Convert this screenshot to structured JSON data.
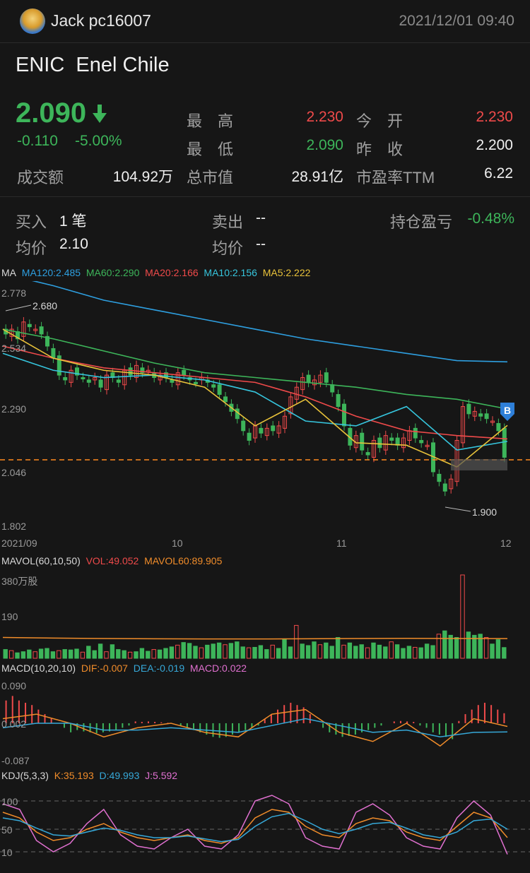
{
  "header": {
    "user": "Jack pc16007",
    "datetime": "2021/12/01 09:40"
  },
  "stock": {
    "ticker": "ENIC",
    "name": "Enel Chile"
  },
  "quote": {
    "price": "2.090",
    "change": "-0.110",
    "change_pct": "-5.00%",
    "turnover_label": "成交额",
    "turnover": "104.92万",
    "high_label": "最　高",
    "high": "2.230",
    "low_label": "最　低",
    "low": "2.090",
    "mktcap_label": "总市值",
    "mktcap": "28.91亿",
    "open_label": "今　开",
    "open": "2.230",
    "prevclose_label": "昨　收",
    "prevclose": "2.200",
    "pe_label": "市盈率TTM",
    "pe": "6.22"
  },
  "position": {
    "buy_label": "买入",
    "buy_value": "1 笔",
    "avg_label": "均价",
    "avg_buy": "2.10",
    "sell_label": "卖出",
    "sell_value": "--",
    "avg_label2": "均价",
    "avg_sell": "--",
    "pnl_label": "持仓盈亏",
    "pnl": "-0.48%"
  },
  "colors": {
    "up": "#ef4a4a",
    "down": "#3db55a",
    "ma120": "#2e9fe0",
    "ma60": "#3db55a",
    "ma20": "#ef4a4a",
    "ma10": "#36c5dd",
    "ma5": "#e8c23a",
    "kdj_k": "#f08c2a",
    "kdj_d": "#36a8d8",
    "kdj_j": "#e070d0"
  },
  "main_legend": {
    "ma": "MA",
    "ma120": "MA120:2.485",
    "ma60": "MA60:2.290",
    "ma20": "MA20:2.166",
    "ma10": "MA10:2.156",
    "ma5": "MA5:2.222"
  },
  "main_axis": {
    "y1": "2.778",
    "y2": "2.534",
    "y3": "2.290",
    "y4": "2.046",
    "y5": "1.802",
    "hi": "2.680",
    "lo": "1.900",
    "x1": "2021/09",
    "x2": "10",
    "x3": "11",
    "x4": "12",
    "badge": "B"
  },
  "vol_legend": {
    "title": "MAVOL(60,10,50)",
    "vol": "VOL:49.052",
    "mavol60": "MAVOL60:89.905",
    "y_top": "380万股",
    "y_mid": "190"
  },
  "macd_legend": {
    "title": "MACD(10,20,10)",
    "dif": "DIF:-0.007",
    "dea": "DEA:-0.019",
    "macd": "MACD:0.022",
    "y_top": "0.090",
    "y_mid": "0.002",
    "y_bot": "-0.087"
  },
  "kdj_legend": {
    "title": "KDJ(5,3,3)",
    "k": "K:35.193",
    "d": "D:49.993",
    "j": "J:5.592",
    "y100": "100",
    "y50": "50",
    "y10": "10"
  },
  "chart_data": [
    {
      "type": "candlestick",
      "title": "ENIC",
      "ylim": [
        1.802,
        2.778
      ],
      "x_ticks": [
        "2021/09",
        "10",
        "11",
        "12"
      ],
      "annotations": {
        "high": 2.68,
        "low": 1.9,
        "last": 2.09
      },
      "closes": [
        2.6,
        2.62,
        2.58,
        2.65,
        2.63,
        2.62,
        2.6,
        2.55,
        2.5,
        2.43,
        2.41,
        2.45,
        2.43,
        2.42,
        2.4,
        2.42,
        2.38,
        2.43,
        2.42,
        2.4,
        2.45,
        2.43,
        2.47,
        2.44,
        2.45,
        2.42,
        2.43,
        2.42,
        2.4,
        2.44,
        2.43,
        2.41,
        2.4,
        2.42,
        2.4,
        2.38,
        2.35,
        2.32,
        2.28,
        2.25,
        2.2,
        2.16,
        2.22,
        2.19,
        2.21,
        2.2,
        2.22,
        2.26,
        2.34,
        2.38,
        2.42,
        2.4,
        2.41,
        2.43,
        2.4,
        2.36,
        2.3,
        2.22,
        2.14,
        2.18,
        2.12,
        2.1,
        2.16,
        2.13,
        2.18,
        2.16,
        2.14,
        2.17,
        2.2,
        2.17,
        2.15,
        2.14,
        2.03,
        1.99,
        1.95,
        2.0,
        2.16,
        2.3,
        2.27,
        2.28,
        2.26,
        2.25,
        2.24,
        2.2,
        2.09
      ],
      "series": [
        {
          "name": "MA120",
          "values": [
            2.85,
            2.8,
            2.74,
            2.7,
            2.66,
            2.62,
            2.58,
            2.55,
            2.52,
            2.49,
            2.485
          ]
        },
        {
          "name": "MA60",
          "values": [
            2.62,
            2.58,
            2.53,
            2.48,
            2.44,
            2.42,
            2.4,
            2.38,
            2.35,
            2.33,
            2.29
          ]
        },
        {
          "name": "MA20",
          "values": [
            2.55,
            2.5,
            2.46,
            2.44,
            2.42,
            2.4,
            2.34,
            2.26,
            2.2,
            2.18,
            2.166
          ]
        },
        {
          "name": "MA10",
          "values": [
            2.52,
            2.45,
            2.42,
            2.43,
            2.41,
            2.36,
            2.24,
            2.22,
            2.3,
            2.12,
            2.156
          ]
        },
        {
          "name": "MA5",
          "values": [
            2.62,
            2.5,
            2.45,
            2.43,
            2.38,
            2.22,
            2.33,
            2.15,
            2.14,
            2.05,
            2.222
          ]
        }
      ]
    },
    {
      "type": "bar",
      "title": "MAVOL(60,10,50)",
      "ylim": [
        0,
        380
      ],
      "values": [
        40,
        35,
        25,
        30,
        38,
        30,
        42,
        45,
        30,
        35,
        40,
        38,
        42,
        28,
        55,
        35,
        65,
        30,
        62,
        40,
        35,
        28,
        30,
        45,
        32,
        40,
        38,
        45,
        52,
        60,
        72,
        68,
        55,
        48,
        60,
        65,
        70,
        62,
        68,
        75,
        52,
        48,
        50,
        58,
        40,
        60,
        45,
        88,
        52,
        150,
        65,
        58,
        75,
        62,
        70,
        55,
        95,
        60,
        70,
        55,
        62,
        48,
        70,
        60,
        52,
        75,
        62,
        45,
        55,
        50,
        48,
        65,
        58,
        110,
        125,
        105,
        95,
        380,
        120,
        105,
        110,
        95,
        65,
        85,
        49
      ],
      "series": [
        {
          "name": "MAVOL60",
          "values": [
            95,
            92,
            90,
            89,
            88,
            88,
            89,
            90,
            91,
            90,
            89.905
          ]
        }
      ]
    },
    {
      "type": "bar",
      "title": "MACD(10,20,10)",
      "ylim": [
        -0.087,
        0.09
      ],
      "values": [
        0.05,
        0.06,
        0.05,
        0.045,
        0.04,
        0.03,
        0.02,
        0.01,
        0.0,
        -0.01,
        -0.02,
        -0.015,
        -0.018,
        -0.02,
        -0.022,
        -0.02,
        -0.018,
        -0.015,
        -0.01,
        -0.005,
        0.004,
        0.003,
        0.004,
        0.003,
        0.002,
        0.001,
        0.0,
        -0.005,
        -0.01,
        -0.015,
        -0.02,
        -0.025,
        -0.03,
        -0.032,
        -0.03,
        -0.025,
        -0.02,
        -0.015,
        -0.01,
        -0.005,
        0.01,
        0.02,
        0.03,
        0.04,
        0.045,
        0.04,
        0.035,
        0.02,
        0.0,
        -0.01,
        -0.02,
        -0.025,
        -0.03,
        -0.028,
        -0.025,
        -0.02,
        -0.015,
        -0.01,
        -0.005,
        0.0,
        0.004,
        0.005,
        0.004,
        0.003,
        -0.005,
        -0.01,
        -0.02,
        -0.025,
        -0.03,
        -0.035,
        0.005,
        0.02,
        0.03,
        0.04,
        0.045,
        0.04,
        0.03,
        0.022
      ],
      "series": [
        {
          "name": "DIF",
          "values": [
            0.01,
            0.02,
            0.0,
            -0.03,
            -0.01,
            0.0,
            -0.02,
            -0.03,
            0.02,
            0.03,
            -0.02,
            -0.04,
            0.0,
            -0.05,
            0.01,
            -0.007
          ]
        },
        {
          "name": "DEA",
          "values": [
            -0.01,
            0.0,
            0.0,
            -0.015,
            -0.015,
            -0.01,
            -0.015,
            -0.02,
            -0.005,
            0.01,
            -0.005,
            -0.02,
            -0.015,
            -0.03,
            -0.02,
            -0.019
          ]
        }
      ]
    },
    {
      "type": "line",
      "title": "KDJ(5,3,3)",
      "ylim": [
        0,
        100
      ],
      "series": [
        {
          "name": "K",
          "values": [
            80,
            70,
            45,
            30,
            35,
            50,
            60,
            45,
            35,
            30,
            35,
            40,
            30,
            25,
            35,
            70,
            85,
            80,
            55,
            40,
            35,
            60,
            70,
            65,
            45,
            35,
            30,
            55,
            80,
            70,
            35.193
          ]
        },
        {
          "name": "D",
          "values": [
            70,
            65,
            52,
            40,
            38,
            45,
            52,
            48,
            40,
            35,
            35,
            38,
            33,
            28,
            32,
            55,
            72,
            78,
            65,
            50,
            42,
            50,
            60,
            62,
            52,
            40,
            35,
            45,
            65,
            68,
            49.993
          ]
        },
        {
          "name": "J",
          "values": [
            95,
            85,
            30,
            10,
            25,
            60,
            85,
            40,
            20,
            15,
            35,
            50,
            20,
            15,
            40,
            100,
            110,
            95,
            35,
            20,
            15,
            80,
            95,
            75,
            35,
            20,
            15,
            70,
            100,
            75,
            5.592
          ]
        }
      ]
    }
  ]
}
